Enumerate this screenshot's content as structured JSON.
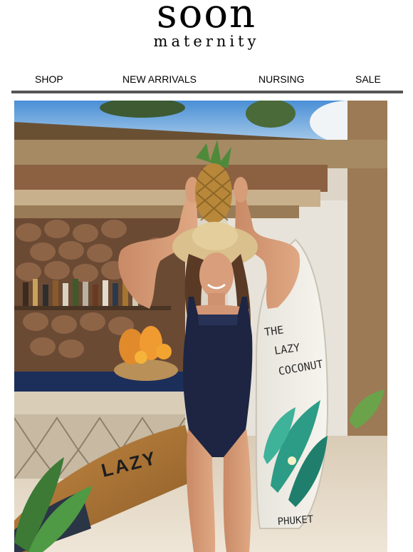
{
  "brand": {
    "name": "soon",
    "tagline": "maternity"
  },
  "nav": {
    "items": [
      {
        "label": "SHOP"
      },
      {
        "label": "NEW ARRIVALS"
      },
      {
        "label": "NURSING"
      },
      {
        "label": "SALE"
      }
    ]
  },
  "hero": {
    "surfboard_text": {
      "line1": "THE",
      "line2": "LAZY",
      "line3": "COCONUT",
      "bottom": "PHUKET"
    },
    "board_text": "LAZY"
  }
}
